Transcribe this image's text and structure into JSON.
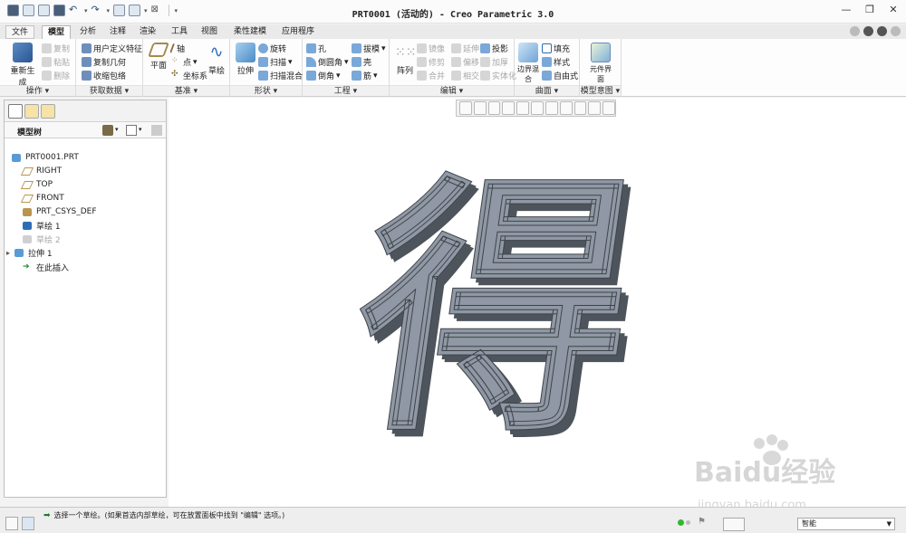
{
  "window": {
    "title": "PRT0001 (活动的) - Creo Parametric 3.0"
  },
  "quick_access": [
    "new-icon",
    "open-icon",
    "save-icon",
    "undo-icon",
    "redo-icon",
    "regenerate-icon",
    "windows-icon",
    "close-icon",
    "customize-icon"
  ],
  "tabs": [
    {
      "label": "文件"
    },
    {
      "label": "模型"
    },
    {
      "label": "分析"
    },
    {
      "label": "注释"
    },
    {
      "label": "渲染"
    },
    {
      "label": "工具"
    },
    {
      "label": "视图"
    },
    {
      "label": "柔性建模"
    },
    {
      "label": "应用程序"
    }
  ],
  "ribbon": {
    "operations": {
      "label": "操作",
      "regenerate": "重新生成",
      "copy": "复制",
      "paste": "粘贴",
      "delete": "删除"
    },
    "get_data": {
      "label": "获取数据",
      "udf": "用户定义特征",
      "copy_geom": "复制几何",
      "shrinkwrap": "收缩包络"
    },
    "datum": {
      "label": "基准",
      "plane": "平面",
      "axis": "轴",
      "point": "点",
      "csys": "坐标系",
      "sketch": "草绘"
    },
    "shapes": {
      "label": "形状",
      "extrude": "拉伸",
      "revolve": "旋转",
      "sweep": "扫描",
      "swept_blend": "扫描混合"
    },
    "engineering": {
      "label": "工程",
      "hole": "孔",
      "round": "倒圆角",
      "chamfer": "倒角",
      "draft": "拔模",
      "shell": "壳",
      "rib": "筋"
    },
    "editing": {
      "label": "编辑",
      "pattern": "阵列",
      "mirror": "镜像",
      "trim": "修剪",
      "merge": "合并",
      "extend": "延伸",
      "offset": "偏移",
      "intersect": "相交",
      "project": "投影",
      "thicken": "加厚",
      "solidify": "实体化"
    },
    "surfaces": {
      "label": "曲面",
      "boundary_blend": "边界混合",
      "fill": "填充",
      "style": "样式",
      "freestyle": "自由式"
    },
    "model_intent": {
      "label": "模型意图",
      "component_interface": "元件界面"
    }
  },
  "left_panel": {
    "tree_title": "模型树",
    "nodes": [
      {
        "label": "PRT0001.PRT",
        "icon": "part-icon",
        "disabled": false
      },
      {
        "label": "RIGHT",
        "icon": "datum-plane-icon",
        "disabled": false
      },
      {
        "label": "TOP",
        "icon": "datum-plane-icon",
        "disabled": false
      },
      {
        "label": "FRONT",
        "icon": "datum-plane-icon",
        "disabled": false
      },
      {
        "label": "PRT_CSYS_DEF",
        "icon": "csys-icon",
        "disabled": false
      },
      {
        "label": "草绘 1",
        "icon": "sketch-icon",
        "disabled": false
      },
      {
        "label": "草绘 2",
        "icon": "sketch-icon",
        "disabled": true
      },
      {
        "label": "拉伸 1",
        "icon": "extrude-icon",
        "disabled": false
      },
      {
        "label": "在此插入",
        "icon": "insert-here-icon",
        "disabled": false
      }
    ]
  },
  "graphics": {
    "model_character": "得",
    "model_color": "#8f98a4",
    "side_color": "#4e545c",
    "background": "#ffffff"
  },
  "status": {
    "message": "选择一个草绘。(如果首选内部草绘，可在放置面板中找到 \"编辑\" 选项。)",
    "filter": "智能"
  },
  "watermark": {
    "brand": "Baidu经验",
    "url": "jingyan.baidu.com"
  }
}
